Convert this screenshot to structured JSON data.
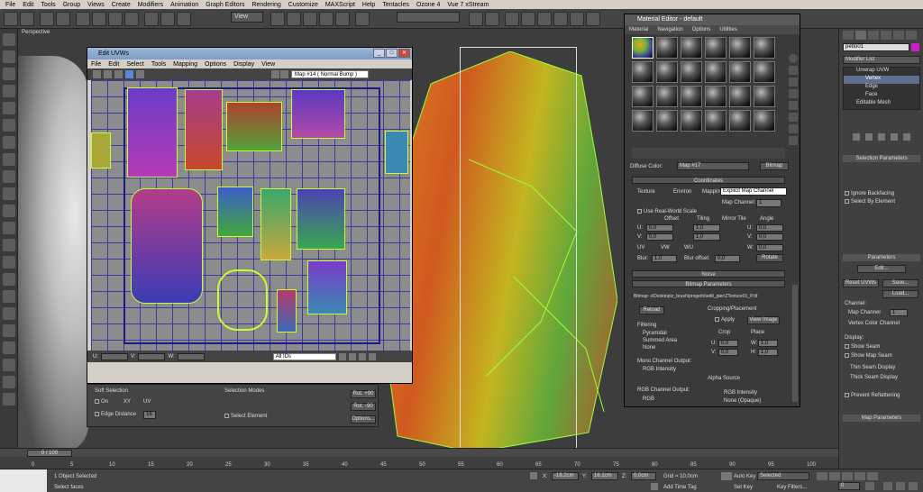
{
  "menubar": [
    "File",
    "Edit",
    "Tools",
    "Group",
    "Views",
    "Create",
    "Modifiers",
    "Animation",
    "Graph Editors",
    "Rendering",
    "Customize",
    "MAXScript",
    "Help",
    "Tentacles",
    "Ozone 4",
    "Vue 7 xStream"
  ],
  "toolbar": {
    "view_dropdown": "View"
  },
  "viewport": {
    "label": "Perspective"
  },
  "uv_editor": {
    "title": "Edit UVWs",
    "menu": [
      "File",
      "Edit",
      "Select",
      "Tools",
      "Mapping",
      "Options",
      "Display",
      "View"
    ],
    "map_dropdown": "Map #14  ( Normal Bump )",
    "u_label": "U:",
    "v_label": "V:",
    "w_label": "W:",
    "id_dropdown": "All IDs"
  },
  "soft_selection": {
    "title": "Soft Selection",
    "on_label": "On",
    "xy_label": "XY",
    "uv_label": "UV",
    "edge_distance_label": "Edge Distance",
    "edge_distance_value": "16",
    "selection_modes_label": "Selection Modes",
    "select_element_label": "Select Element",
    "rot_plus": "Rot. +90",
    "rot_minus": "Rot. -90",
    "options": "Options..."
  },
  "material_editor": {
    "title": "Material Editor - default",
    "menu": [
      "Material",
      "Navigation",
      "Options",
      "Utilities"
    ],
    "diffuse_label": "Diffuse Color:",
    "map_name": "Map #17",
    "map_type": "Bitmap",
    "coordinates": "Coordinates",
    "texture": "Texture",
    "environ": "Environ",
    "mapping_label": "Mapping:",
    "mapping_value": "Explicit Map Channel",
    "map_channel_label": "Map Channel:",
    "map_channel_value": "1",
    "use_real_world": "Use Real-World Scale",
    "offset": "Offset",
    "tiling": "Tiling",
    "mirror_tile": "Mirror Tile",
    "angle": "Angle",
    "u": "U:",
    "v": "V:",
    "w": "W:",
    "u_offset": "0,0",
    "u_tiling": "1,0",
    "u_angle": "0,0",
    "v_offset": "0,0",
    "v_tiling": "1,0",
    "v_angle": "0,0",
    "w_angle": "0,0",
    "uv_option": "UV",
    "vw_option": "VW",
    "wu_option": "WU",
    "blur_label": "Blur:",
    "blur_value": "1,0",
    "blur_offset_label": "Blur offset:",
    "blur_offset_value": "0,0",
    "rotate": "Rotate",
    "noise": "Noise",
    "bitmap_params": "Bitmap Parameters",
    "bitmap_path": "Bitmap: s\\Desktop\\z_brush\\progetto\\edit_pier\\ZTexture01_P.tif",
    "reload": "Reload",
    "cropping": "Cropping/Placement",
    "apply": "Apply",
    "view_image": "View Image",
    "crop": "Crop",
    "place": "Place",
    "crop_u": "0,0",
    "crop_w": "1,0",
    "crop_v": "0,0",
    "crop_h": "1,0",
    "filtering": "Filtering",
    "pyramidal": "Pyramidal",
    "summed_area": "Summed Area",
    "none": "None",
    "mono_output": "Mono Channel Output:",
    "rgb_intensity": "RGB Intensity",
    "alpha_source": "Alpha Source",
    "rgb_output": "RGB Channel Output:",
    "rgb": "RGB",
    "rgb_intensity2": "RGB Intensity",
    "none_opaque": "None (Opaque)"
  },
  "command_panel": {
    "object_name": "petto01",
    "modifier_list": "Modifier List",
    "stack": [
      "Unwrap UVW",
      "Vertex",
      "Edge",
      "Face",
      "Editable Mesh"
    ],
    "selection_params": "Selection Parameters",
    "ignore_backfacing": "Ignore Backfacing",
    "select_by_element": "Select By Element",
    "parameters": "Parameters",
    "edit": "Edit...",
    "reset_uvws": "Reset UVWs",
    "save": "Save...",
    "load": "Load...",
    "channel": "Channel:",
    "map_channel": "Map Channel",
    "map_channel_value": "1",
    "vertex_color_channel": "Vertex Color Channel",
    "display": "Display:",
    "show_seam": "Show Seam",
    "show_map_seam": "Show Map Seam",
    "thin_seam": "Thin Seam Display",
    "thick_seam": "Thick Seam Display",
    "prevent_reflattening": "Prevent Reflattening",
    "map_parameters": "Map Parameters"
  },
  "timeline": {
    "frame": "0 / 100",
    "ticks": [
      "0",
      "5",
      "10",
      "15",
      "20",
      "25",
      "30",
      "35",
      "40",
      "45",
      "50",
      "55",
      "60",
      "65",
      "70",
      "75",
      "80",
      "85",
      "90",
      "95",
      "100"
    ]
  },
  "status": {
    "selected": "1 Object Selected",
    "prompt": "Select faces",
    "x_label": "X:",
    "x_value": "-18.2cm",
    "y_label": "Y:",
    "y_value": "16.1cm",
    "z_label": "Z:",
    "z_value": "0,0cm",
    "grid": "Grid = 10,0cm",
    "add_time_tag": "Add Time Tag",
    "auto_key": "Auto Key",
    "selected_dropdown": "Selected",
    "set_key": "Set Key",
    "key_filters": "Key Filters...",
    "frame_value": "0"
  }
}
